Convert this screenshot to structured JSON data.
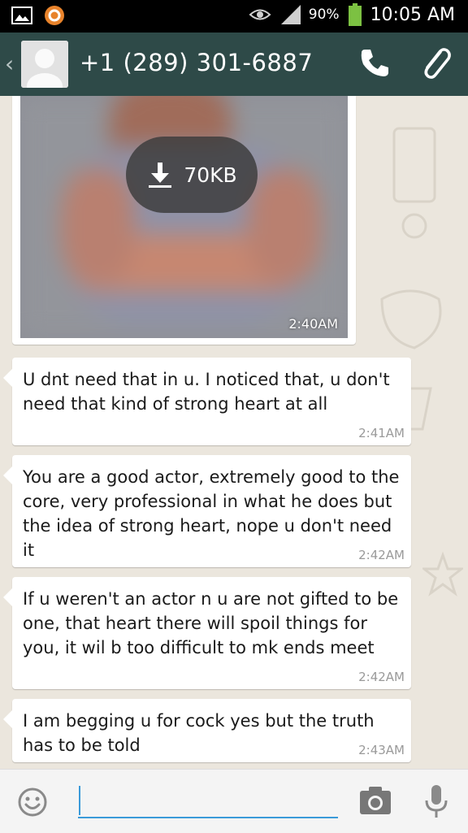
{
  "status_bar": {
    "battery": "90%",
    "time": "10:05 AM"
  },
  "header": {
    "contact_name": "+1 (289) 301-6887"
  },
  "image_message": {
    "download_size": "70KB",
    "time": "2:40AM"
  },
  "messages": [
    {
      "text": "U dnt need that in u. I noticed that, u don't need that kind of strong heart at all",
      "time": "2:41AM"
    },
    {
      "text": "You are a good actor, extremely good to the core, very professional in what he does but the idea of strong heart, nope u don't need it",
      "time": "2:42AM"
    },
    {
      "text": "If u weren't an actor n u are not gifted to be one, that heart there will spoil things for you, it wil b too difficult to mk ends meet",
      "time": "2:42AM"
    },
    {
      "text": "I am begging u for cock yes but the truth has to be told",
      "time": "2:43AM"
    }
  ],
  "input": {
    "value": "",
    "placeholder": ""
  },
  "colors": {
    "header": "#2e4a48",
    "accent": "#3a9ad9",
    "chat_bg": "#ebe6dd"
  }
}
